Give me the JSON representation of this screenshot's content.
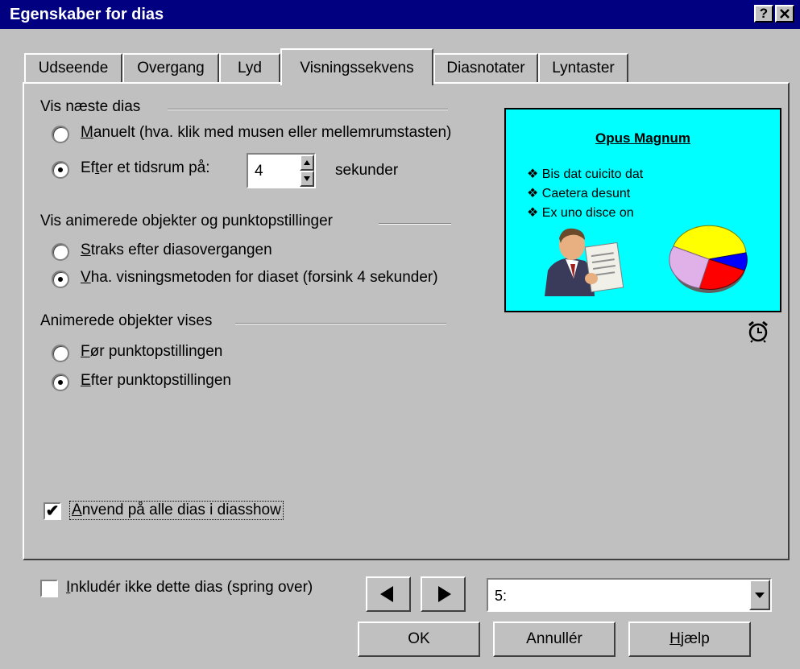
{
  "window": {
    "title": "Egenskaber for dias",
    "help_button": "?",
    "close_button": "✕"
  },
  "tabs": [
    {
      "label": "Udseende"
    },
    {
      "label": "Overgang"
    },
    {
      "label": "Lyd"
    },
    {
      "label": "Visningssekvens",
      "active": true
    },
    {
      "label": "Diasnotater"
    },
    {
      "label": "Lyntaster"
    }
  ],
  "next_slide": {
    "group_label": "Vis næste dias",
    "option_manual": {
      "accel": "M",
      "rest": "anuelt (hva. klik med musen eller mellemrumstasten)",
      "selected": false
    },
    "option_timed": {
      "pre": "Ef",
      "accel": "t",
      "rest": "er et tidsrum på:",
      "selected": true
    },
    "seconds_value": "4",
    "seconds_unit": "sekunder"
  },
  "animated_objects": {
    "group_label": "Vis animerede objekter og punktopstillinger",
    "option_immediate": {
      "accel": "S",
      "rest": "traks efter diasovergangen",
      "selected": false
    },
    "option_method": {
      "accel": "V",
      "rest": "ha. visningsmetoden for diaset (forsink 4 sekunder)",
      "selected": true
    }
  },
  "animated_show": {
    "group_label": "Animerede objekter vises",
    "option_before": {
      "accel": "F",
      "rest": "ør punktopstillingen",
      "selected": false
    },
    "option_after": {
      "accel": "E",
      "rest": "fter punktopstillingen",
      "selected": true
    }
  },
  "apply_all": {
    "accel": "A",
    "rest": "nvend på alle dias i diasshow",
    "checked": true
  },
  "preview": {
    "title": "Opus Magnum",
    "bullets": [
      "Bis dat cuicito dat",
      "Caetera desunt",
      "Ex uno disce on"
    ],
    "bullet_glyph": "❖",
    "background": "#00ffff",
    "pie_colors": [
      "#ffff00",
      "#0000ff",
      "#ff0000",
      "#e0b0e0"
    ]
  },
  "footer": {
    "skip_checkbox": {
      "accel": "I",
      "rest": "nkludér ikke dette dias (spring over)",
      "checked": false
    },
    "slide_select_value": "5:",
    "ok_label": "OK",
    "cancel_label": "Annullér",
    "help_pre": "",
    "help_accel": "H",
    "help_rest": "jælp"
  }
}
